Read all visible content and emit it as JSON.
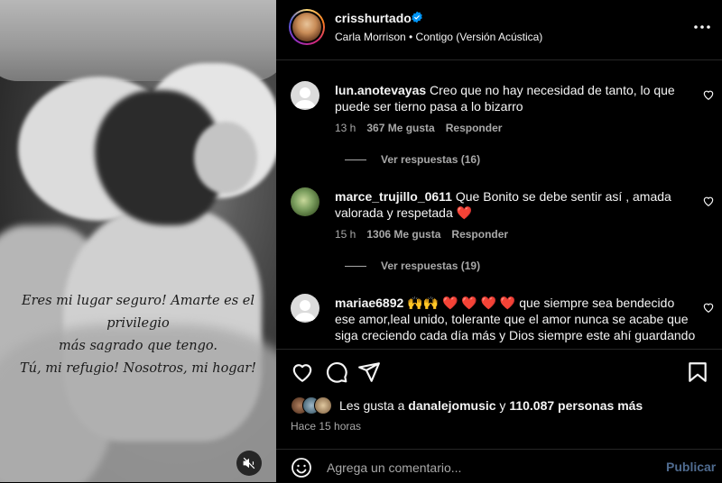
{
  "post": {
    "caption_lines": [
      "Eres mi lugar seguro! Amarte es el privilegio",
      "más sagrado que tengo.",
      "Tú, mi refugio! Nosotros, mi hogar!"
    ]
  },
  "header": {
    "username": "crisshurtado",
    "song": "Carla Morrison • Contigo (Versión Acústica)"
  },
  "comments": [
    {
      "username": "lun.anotevayas",
      "text_line1": "Creo que no hay necesidad de tanto, lo que",
      "text_line2": "puede ser tierno pasa a lo bizarro",
      "time": "13 h",
      "likes": "367 Me gusta",
      "reply": "Responder",
      "view_replies": "Ver respuestas (16)"
    },
    {
      "username": "marce_trujillo_0611",
      "text_line1": "Que Bonito se debe sentir así , amada",
      "text_line2": "valorada y respetada ❤️",
      "time": "15 h",
      "likes": "1306 Me gusta",
      "reply": "Responder",
      "view_replies": "Ver respuestas (19)"
    },
    {
      "username": "mariae6892",
      "text_line1": "🙌🙌 ❤️ ❤️ ❤️ ❤️ que siempre sea bendecido",
      "text_line2": "ese amor,leal unido, tolerante que el amor nunca se acabe que",
      "text_line3": "siga creciendo cada día más y Dios siempre este ahí guardando"
    }
  ],
  "likes": {
    "prefix": "Les gusta a ",
    "user": "danalejomusic",
    "middle": " y ",
    "others": "110.087 personas más"
  },
  "time_ago": "Hace 15 horas",
  "add_comment": {
    "placeholder": "Agrega un comentario...",
    "publish": "Publicar"
  },
  "colors": {
    "accent_link": "#4f6b8f",
    "verified": "#0095f6",
    "heart_emoji": "#e0245e"
  },
  "icons": [
    "heart-icon",
    "comment-icon",
    "share-icon",
    "bookmark-icon",
    "emoji-icon",
    "mute-icon",
    "more-icon",
    "verified-badge-icon"
  ]
}
